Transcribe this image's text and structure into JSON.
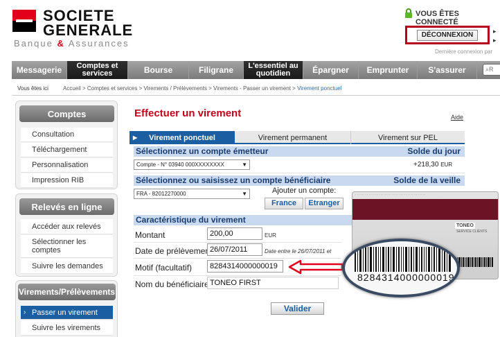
{
  "header": {
    "brand_line1": "SOCIETE",
    "brand_line2": "GENERALE",
    "tagline_part1": "Banque ",
    "tagline_amp": "&",
    "tagline_part2": " Assurances",
    "secure_text": "VOUS ÊTES CONNECTÉ",
    "logout_label": "DÉCONNEXION",
    "last_connection": "Dernière connexion par",
    "brand_red": "#e2001a"
  },
  "nav": {
    "items": [
      {
        "label": "Messagerie"
      },
      {
        "label": "Comptes et services"
      },
      {
        "label": "Bourse"
      },
      {
        "label": "Filigrane"
      },
      {
        "label": "L'essentiel au quotidien"
      },
      {
        "label": "Épargner"
      },
      {
        "label": "Emprunter"
      },
      {
        "label": "S'assurer"
      }
    ],
    "search_placeholder": "R"
  },
  "breadcrumb": {
    "here_label": "Vous êtes ici",
    "path": "Accueil > Comptes et services > Virements / Prélèvements > Virements - Passer un virement > ",
    "current": "Virement ponctuel"
  },
  "sidebar": {
    "comptes": {
      "title": "Comptes",
      "items": [
        "Consultation",
        "Téléchargement",
        "Personnalisation",
        "Impression RIB"
      ]
    },
    "releves": {
      "title": "Relevés en ligne",
      "items": [
        "Accéder aux relevés",
        "Sélectionner les comptes",
        "Suivre les demandes"
      ]
    },
    "virements": {
      "title": "Virements/Prélèvements",
      "items": [
        "Passer un virement",
        "Suivre les virements"
      ]
    },
    "active_color": "#1c5ea2"
  },
  "main": {
    "title": "Effectuer un virement",
    "aide": "Aide",
    "tabs": [
      "Virement ponctuel",
      "Virement permanent",
      "Virement sur PEL"
    ],
    "emetteur": {
      "header": "Sélectionnez un compte émetteur",
      "right_header": "Solde du jour",
      "select_value": "Compte -  N° 03940 000XXXXXXXX",
      "balance": "+218,30",
      "currency": "EUR"
    },
    "beneficiaire": {
      "header": "Sélectionnez ou saisissez un compte bénéficiaire",
      "right_header": "Solde de la veille",
      "select_value": "FRA - 82012270000",
      "add_label": "Ajouter un compte:",
      "france_btn": "France",
      "etranger_btn": "Etranger"
    },
    "caracteristique": {
      "header": "Caractéristique du virement",
      "montant_label": "Montant",
      "montant_value": "200,00",
      "unit": "EUR",
      "date_label": "Date de prélèvement",
      "date_value": "26/07/2011",
      "date_note": "Date entre le 26/07/2011 et",
      "motif_label": "Motif (facultatif)",
      "motif_value": "8284314000000019",
      "nom_label": "Nom du bénéficiaire",
      "nom_value": "TONEO FIRST"
    },
    "valider": "Valider"
  },
  "card": {
    "brand": "TONEO",
    "service_text": "SERVICE CLIENTS",
    "magnified_number": "8284314000000019"
  }
}
